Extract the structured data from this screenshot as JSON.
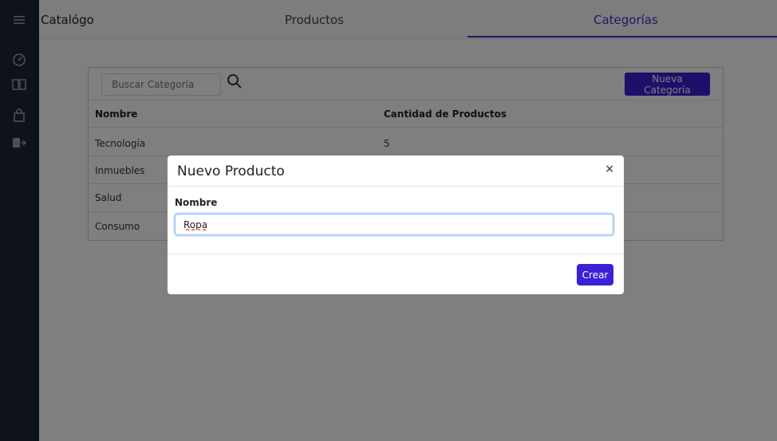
{
  "header": {
    "app_title": "Catalógo",
    "tabs": [
      {
        "label": "Productos"
      },
      {
        "label": "Categorías",
        "active": true
      }
    ]
  },
  "sidebar": {
    "icons": [
      "menu-icon",
      "dashboard-icon",
      "book-icon",
      "shopping-bag-icon",
      "logout-icon"
    ]
  },
  "search": {
    "placeholder": "Buscar Categoría"
  },
  "new_category_button": "Nueva Categoría",
  "table": {
    "columns": [
      "Nombre",
      "Cantidad de Productos"
    ],
    "rows": [
      {
        "name": "Tecnología",
        "count": "5"
      },
      {
        "name": "Inmuebles",
        "count": ""
      },
      {
        "name": "Salud",
        "count": ""
      },
      {
        "name": "Consumo",
        "count": ""
      }
    ]
  },
  "modal": {
    "title": "Nuevo Producto",
    "close": "×",
    "field_label": "Nombre",
    "field_value": "Ropa",
    "submit": "Crear"
  },
  "colors": {
    "accent": "#3a20d6",
    "sidebar": "#1c2733"
  }
}
